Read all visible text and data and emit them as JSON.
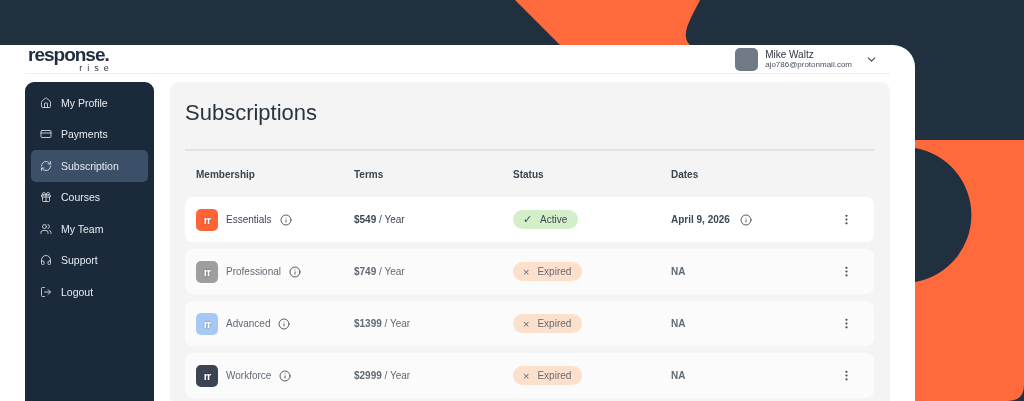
{
  "logo": {
    "wordmark": "response.",
    "tagline": "rise"
  },
  "user": {
    "name": "Mike Waltz",
    "email": "ajo786@protonmail.com"
  },
  "sidebar": {
    "items": [
      {
        "label": "My Profile",
        "selected": false
      },
      {
        "label": "Payments",
        "selected": false
      },
      {
        "label": "Subscription",
        "selected": true
      },
      {
        "label": "Courses",
        "selected": false
      },
      {
        "label": "My Team",
        "selected": false
      },
      {
        "label": "Support",
        "selected": false
      },
      {
        "label": "Logout",
        "selected": false
      }
    ]
  },
  "page_title": "Subscriptions",
  "table": {
    "columns": [
      "Membership",
      "Terms",
      "Status",
      "Dates"
    ],
    "rows": [
      {
        "plan": "Essentials",
        "logo_text": "rr",
        "color": "#ff6436",
        "terms": "**$549** / Year",
        "status": {
          "kind": "active",
          "label": "Active",
          "icon": "✓"
        },
        "date": "April 9, 2026",
        "date_info": true
      },
      {
        "plan": "Professional",
        "logo_text": "rr",
        "color": "#9e9e9e",
        "terms": "**$749** / Year",
        "status": {
          "kind": "expired",
          "label": "Expired",
          "icon": "×"
        },
        "date": "NA",
        "date_info": false
      },
      {
        "plan": "Advanced",
        "logo_text": "rr",
        "color": "#a6c8f5",
        "terms": "**$1399** / Year",
        "status": {
          "kind": "expired",
          "label": "Expired",
          "icon": "×"
        },
        "date": "NA",
        "date_info": false
      },
      {
        "plan": "Workforce",
        "logo_text": "rr",
        "color": "#3a4452",
        "terms": "**$2999** / Year",
        "status": {
          "kind": "expired",
          "label": "Expired",
          "icon": "×"
        },
        "date": "NA",
        "date_info": false
      }
    ]
  }
}
